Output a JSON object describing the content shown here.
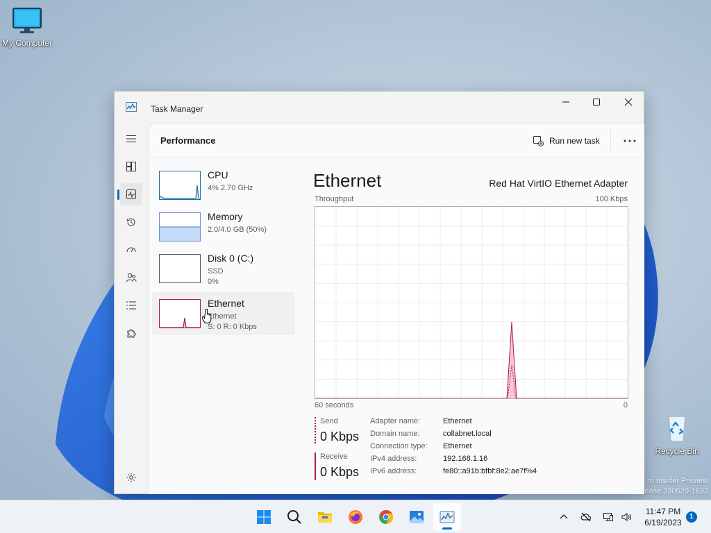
{
  "desktop": {
    "icons": [
      {
        "label": "My Computer"
      },
      {
        "label": "Recycle Bin"
      }
    ],
    "watermark": {
      "line1": "ro Insider Preview",
      "line2": "lease.230520-1632"
    }
  },
  "window": {
    "title": "Task Manager",
    "page_title": "Performance",
    "run_new_task": "Run new task"
  },
  "resources": [
    {
      "name": "CPU",
      "line1": "4%  2.70 GHz",
      "line2": ""
    },
    {
      "name": "Memory",
      "line1": "2.0/4.0 GB (50%)",
      "line2": ""
    },
    {
      "name": "Disk 0 (C:)",
      "line1": "SSD",
      "line2": "0%"
    },
    {
      "name": "Ethernet",
      "line1": "Ethernet",
      "line2": "S: 0  R: 0 Kbps"
    }
  ],
  "detail": {
    "title": "Ethernet",
    "adapter": "Red Hat VirtIO Ethernet Adapter",
    "throughput_label": "Throughput",
    "max_label": "100 Kbps",
    "time_label": "60 seconds",
    "min_label": "0",
    "send_label": "Send",
    "send_value": "0 Kbps",
    "receive_label": "Receive",
    "receive_value": "0 Kbps",
    "properties": [
      {
        "key": "Adapter name:",
        "value": "Ethernet"
      },
      {
        "key": "Domain name:",
        "value": "collabnet.local"
      },
      {
        "key": "Connection type:",
        "value": "Ethernet"
      },
      {
        "key": "IPv4 address:",
        "value": "192.168.1.16"
      },
      {
        "key": "IPv6 address:",
        "value": "fe80::a91b:bfbf:8e2:ae7f%4"
      }
    ]
  },
  "colors": {
    "accent": "#0067c0",
    "ethernet": "#a7203e",
    "cpu": "#1f6c9e",
    "memory": "#6a8fcc"
  },
  "taskbar": {
    "time": "11:47 PM",
    "date": "6/19/2023",
    "notification_count": "1"
  }
}
